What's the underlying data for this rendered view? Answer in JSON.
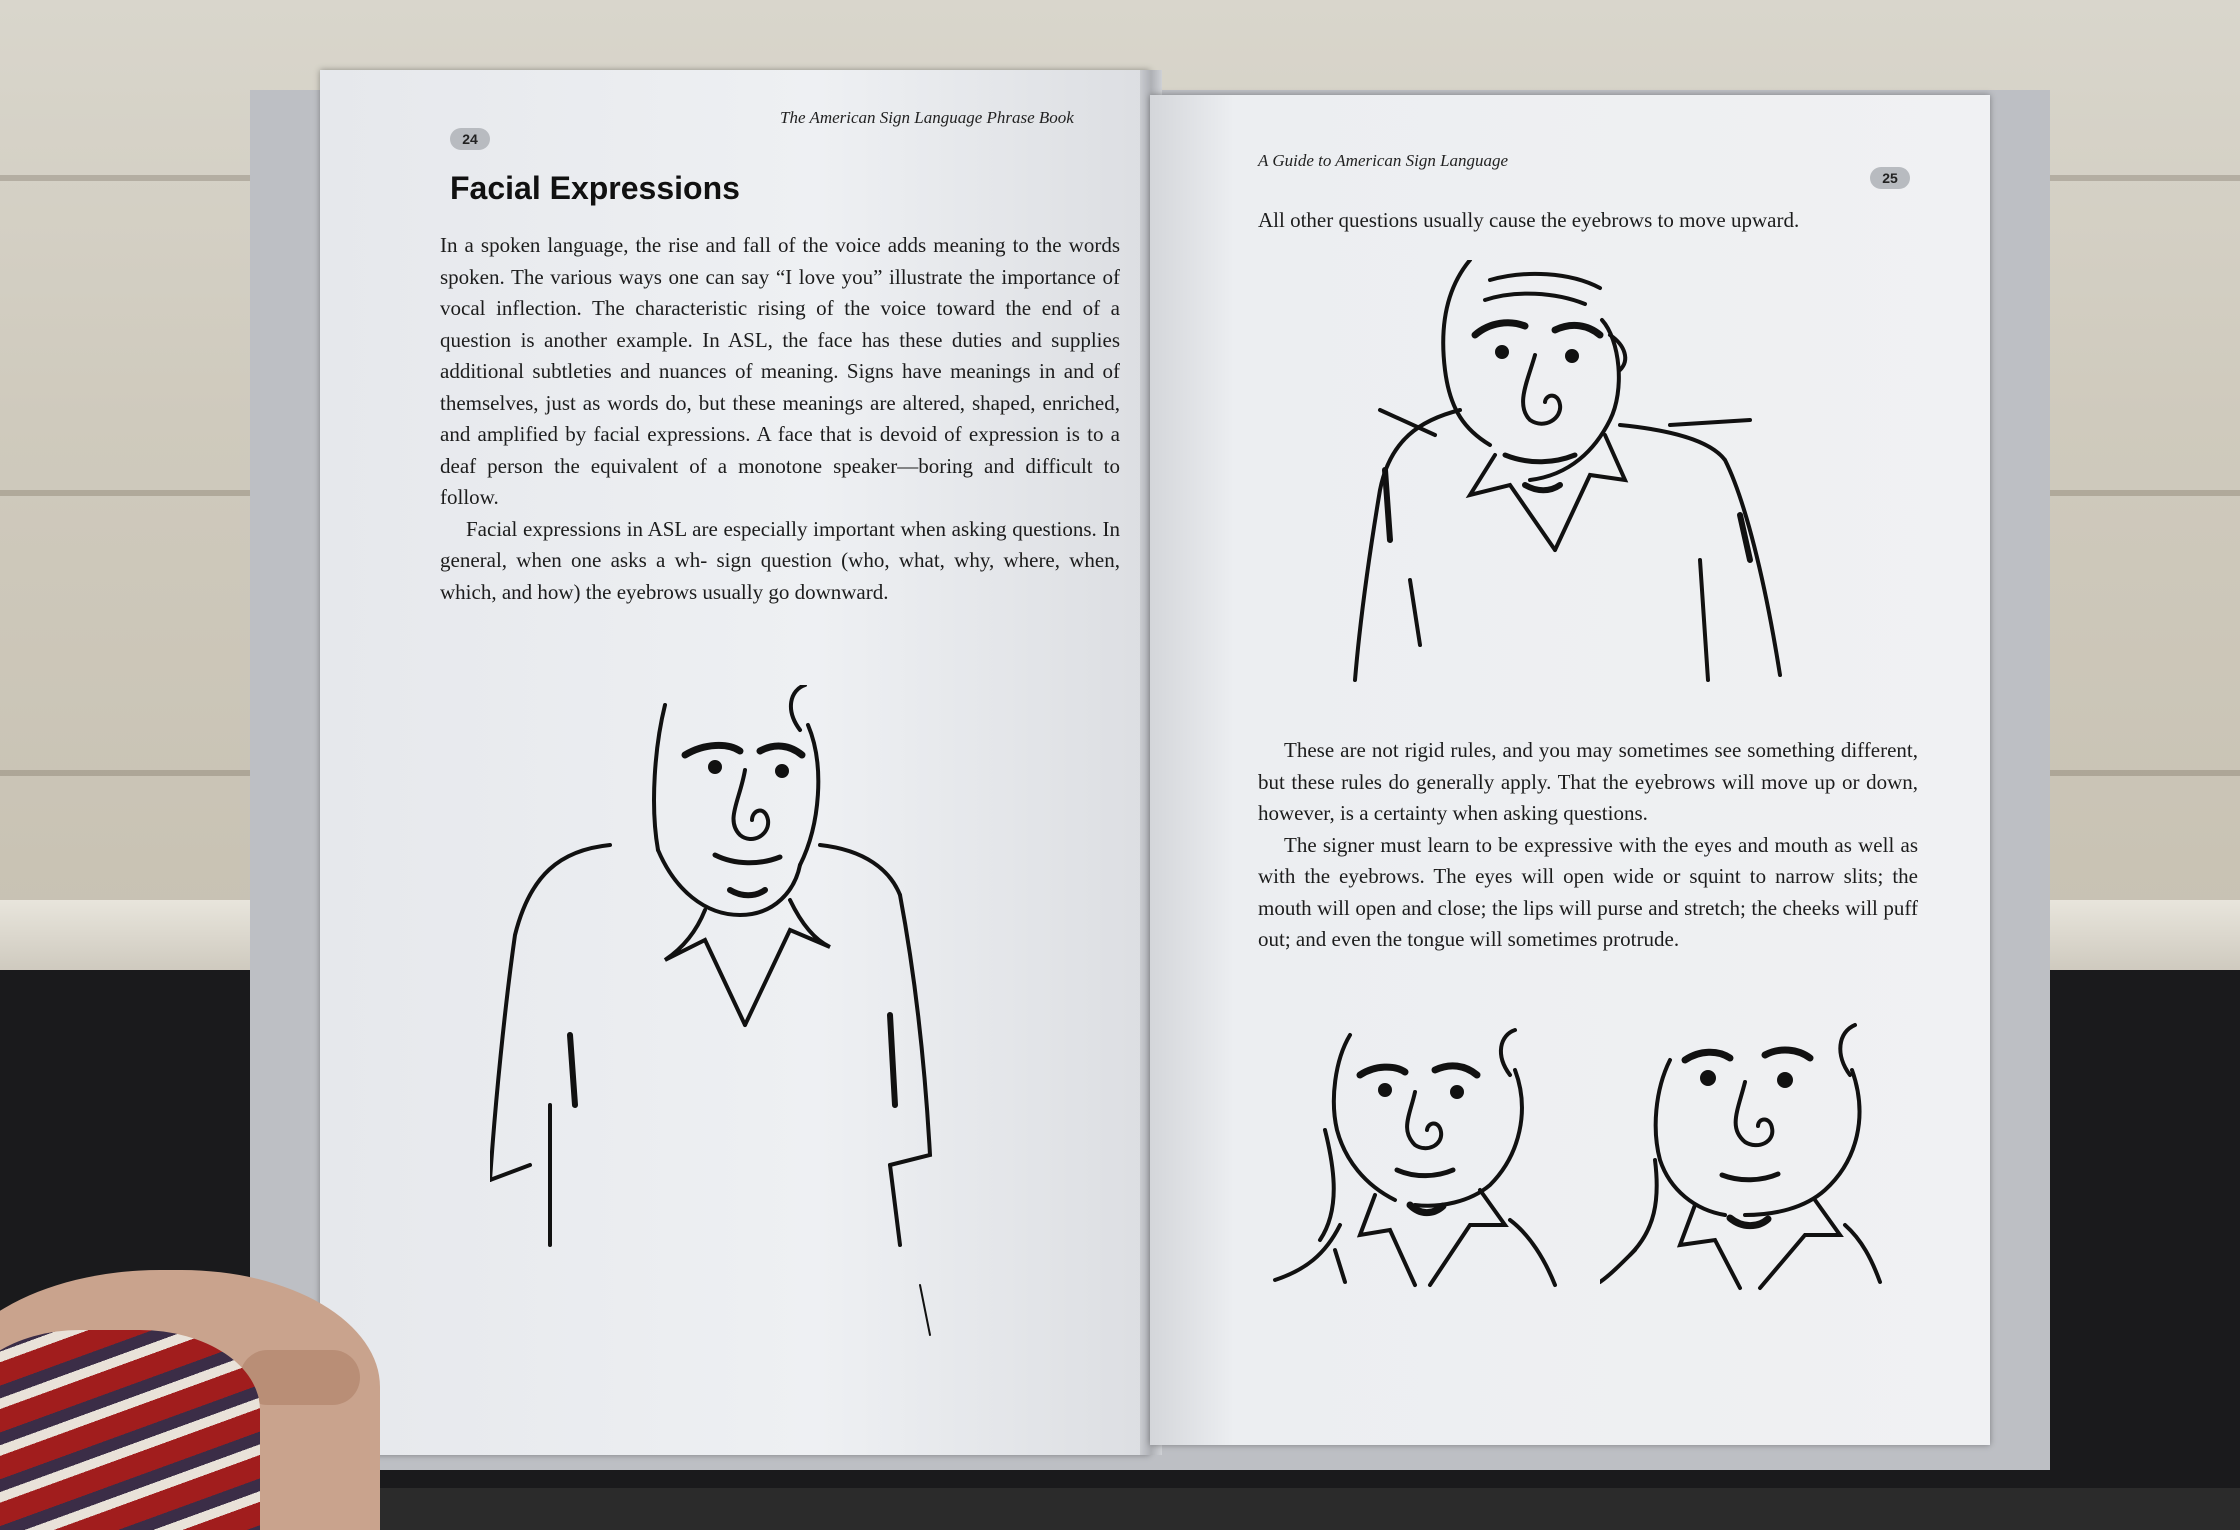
{
  "left_page": {
    "running_head": "The American Sign Language Phrase Book",
    "page_number": "24",
    "heading": "Facial Expressions",
    "paragraph_1": "In a spoken language, the rise and fall of the voice adds meaning to the words spoken. The various ways one can say “I love you” illustrate the importance of vocal inflection. The characteristic rising of the voice toward the end of a question is another example. In ASL, the face has these duties and supplies additional subtleties and nuances of meaning. Signs have meanings in and of themselves, just as words do, but these meanings are altered, shaped, enriched, and amplified by facial expressions. A face that is devoid of expression is to a deaf person the equivalent of a monotone speaker—boring and difficult to follow.",
    "paragraph_2": "Facial expressions in ASL are especially important when asking questions. In general, when one asks a wh- sign question (who, what, why, where, when, which, and how) the eyebrows usually go downward.",
    "illustration": "man-frowning-eyebrows-down"
  },
  "right_page": {
    "running_head": "A Guide to American Sign Language",
    "page_number": "25",
    "opening_line": "All other questions usually cause the eyebrows to move upward.",
    "illustration_top": "man-eyebrows-raised",
    "paragraph_1": "These are not rigid rules, and you may sometimes see something different, but these rules do generally apply. That the eyebrows will move up or down, however, is a certainty when asking questions.",
    "paragraph_2": "The signer must learn to be expressive with the eyes and mouth as well as with the eyebrows. The eyes will open wide or squint to narrow slits; the mouth will open and close; the lips will purse and stretch; the cheeks will puff out; and even the tongue will sometimes protrude.",
    "illustrations_bottom": [
      "man-face-squint",
      "man-face-wide-eyes"
    ]
  }
}
